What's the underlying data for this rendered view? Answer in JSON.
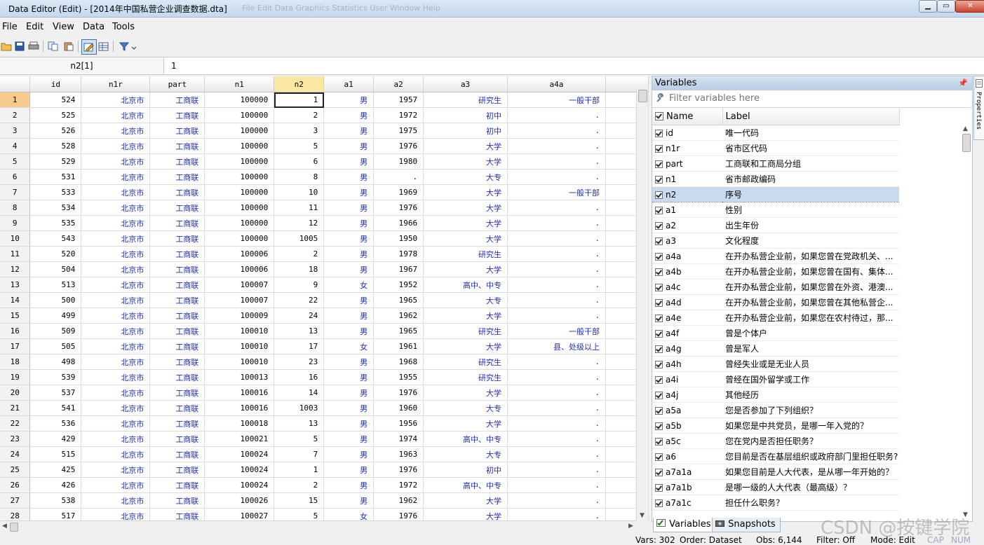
{
  "window": {
    "title": "Data Editor (Edit) - [2014年中国私营企业调查数据.dta]",
    "ghost_menu": "File   Edit   Data   Graphics   Statistics   User   Window   Help"
  },
  "menu": [
    "File",
    "Edit",
    "View",
    "Data",
    "Tools"
  ],
  "toolbar": {
    "icons": [
      "open-icon",
      "save-icon",
      "print-icon",
      "copy-icon",
      "paste-icon",
      "edit-mode-icon",
      "browse-mode-icon",
      "filter-icon"
    ]
  },
  "cellbar": {
    "ref": "n2[1]",
    "value": "1"
  },
  "grid": {
    "columns": [
      "id",
      "n1r",
      "part",
      "n1",
      "n2",
      "a1",
      "a2",
      "a3",
      "a4a"
    ],
    "rows": [
      [
        "1",
        "524",
        "北京市",
        "工商联",
        "100000",
        "1",
        "男",
        "1957",
        "研究生",
        "一般干部"
      ],
      [
        "2",
        "525",
        "北京市",
        "工商联",
        "100000",
        "2",
        "男",
        "1972",
        "初中",
        "."
      ],
      [
        "3",
        "526",
        "北京市",
        "工商联",
        "100000",
        "3",
        "男",
        "1975",
        "初中",
        "."
      ],
      [
        "4",
        "528",
        "北京市",
        "工商联",
        "100000",
        "5",
        "男",
        "1976",
        "大学",
        "."
      ],
      [
        "5",
        "529",
        "北京市",
        "工商联",
        "100000",
        "6",
        "男",
        "1980",
        "大学",
        "."
      ],
      [
        "6",
        "531",
        "北京市",
        "工商联",
        "100000",
        "8",
        "男",
        ".",
        "大专",
        "."
      ],
      [
        "7",
        "533",
        "北京市",
        "工商联",
        "100000",
        "10",
        "男",
        "1969",
        "大学",
        "一般干部"
      ],
      [
        "8",
        "534",
        "北京市",
        "工商联",
        "100000",
        "11",
        "男",
        "1976",
        "大学",
        "."
      ],
      [
        "9",
        "535",
        "北京市",
        "工商联",
        "100000",
        "12",
        "男",
        "1966",
        "大学",
        "."
      ],
      [
        "10",
        "543",
        "北京市",
        "工商联",
        "100000",
        "1005",
        "男",
        "1950",
        "大学",
        "."
      ],
      [
        "11",
        "520",
        "北京市",
        "工商联",
        "100006",
        "2",
        "男",
        "1978",
        "研究生",
        "."
      ],
      [
        "12",
        "504",
        "北京市",
        "工商联",
        "100006",
        "18",
        "男",
        "1967",
        "大学",
        "."
      ],
      [
        "13",
        "513",
        "北京市",
        "工商联",
        "100007",
        "9",
        "女",
        "1952",
        "高中、中专",
        "."
      ],
      [
        "14",
        "500",
        "北京市",
        "工商联",
        "100007",
        "22",
        "男",
        "1965",
        "大专",
        "."
      ],
      [
        "15",
        "499",
        "北京市",
        "工商联",
        "100009",
        "24",
        "男",
        "1962",
        "大学",
        "."
      ],
      [
        "16",
        "509",
        "北京市",
        "工商联",
        "100010",
        "13",
        "男",
        "1965",
        "研究生",
        "一般干部"
      ],
      [
        "17",
        "505",
        "北京市",
        "工商联",
        "100010",
        "17",
        "女",
        "1961",
        "大学",
        "县、处级以上"
      ],
      [
        "18",
        "498",
        "北京市",
        "工商联",
        "100010",
        "23",
        "男",
        "1968",
        "研究生",
        "."
      ],
      [
        "19",
        "539",
        "北京市",
        "工商联",
        "100013",
        "16",
        "男",
        "1955",
        "研究生",
        "."
      ],
      [
        "20",
        "537",
        "北京市",
        "工商联",
        "100016",
        "14",
        "男",
        "1976",
        "大学",
        "."
      ],
      [
        "21",
        "541",
        "北京市",
        "工商联",
        "100016",
        "1003",
        "男",
        "1960",
        "大专",
        "."
      ],
      [
        "22",
        "536",
        "北京市",
        "工商联",
        "100018",
        "13",
        "男",
        "1956",
        "大学",
        "."
      ],
      [
        "23",
        "429",
        "北京市",
        "工商联",
        "100021",
        "5",
        "男",
        "1974",
        "高中、中专",
        "."
      ],
      [
        "24",
        "515",
        "北京市",
        "工商联",
        "100024",
        "7",
        "男",
        "1963",
        "大专",
        "."
      ],
      [
        "25",
        "425",
        "北京市",
        "工商联",
        "100024",
        "1",
        "男",
        "1976",
        "初中",
        "."
      ],
      [
        "26",
        "426",
        "北京市",
        "工商联",
        "100024",
        "2",
        "男",
        "1972",
        "高中、中专",
        "."
      ],
      [
        "27",
        "538",
        "北京市",
        "工商联",
        "100026",
        "15",
        "男",
        "1962",
        "大学",
        "."
      ],
      [
        "28",
        "517",
        "北京市",
        "工商联",
        "100027",
        "5",
        "女",
        "1976",
        "大学",
        "."
      ]
    ]
  },
  "variables": {
    "title": "Variables",
    "filter_placeholder": "Filter variables here",
    "col_name": "Name",
    "col_label": "Label",
    "items": [
      {
        "name": "id",
        "label": "唯一代码"
      },
      {
        "name": "n1r",
        "label": "省市区代码"
      },
      {
        "name": "part",
        "label": "工商联和工商局分组"
      },
      {
        "name": "n1",
        "label": "省市邮政编码"
      },
      {
        "name": "n2",
        "label": "序号"
      },
      {
        "name": "a1",
        "label": "性别"
      },
      {
        "name": "a2",
        "label": "出生年份"
      },
      {
        "name": "a3",
        "label": "文化程度"
      },
      {
        "name": "a4a",
        "label": "在开办私营企业前，如果您曾在党政机关、..."
      },
      {
        "name": "a4b",
        "label": "在开办私营企业前，如果您曾在国有、集体..."
      },
      {
        "name": "a4c",
        "label": "在开办私营企业前，如果您曾在外资、港澳..."
      },
      {
        "name": "a4d",
        "label": "在开办私营企业前，如果您曾在其他私营企..."
      },
      {
        "name": "a4e",
        "label": "在开办私营企业前，如果您在农村待过，那..."
      },
      {
        "name": "a4f",
        "label": "曾是个体户"
      },
      {
        "name": "a4g",
        "label": "曾是军人"
      },
      {
        "name": "a4h",
        "label": "曾经失业或是无业人员"
      },
      {
        "name": "a4i",
        "label": "曾经在国外留学或工作"
      },
      {
        "name": "a4j",
        "label": "其他经历"
      },
      {
        "name": "a5a",
        "label": "您是否参加了下列组织？"
      },
      {
        "name": "a5b",
        "label": "如果您是中共党员，是哪一年入党的？"
      },
      {
        "name": "a5c",
        "label": "您在党内是否担任职务？"
      },
      {
        "name": "a6",
        "label": "您目前是否在基层组织或政府部门里担任职务?"
      },
      {
        "name": "a7a1a",
        "label": "如果您目前是人大代表，是从哪一年开始的？"
      },
      {
        "name": "a7a1b",
        "label": "是哪一级的人大代表（最高级）？"
      },
      {
        "name": "a7a1c",
        "label": "担任什么职务？"
      }
    ]
  },
  "tabs": {
    "variables": "Variables",
    "snapshots": "Snapshots"
  },
  "properties_label": "Properties",
  "status": {
    "vars": "Vars: 302",
    "order": "Order: Dataset",
    "obs": "Obs: 6,144",
    "filter": "Filter: Off",
    "mode": "Mode: Edit",
    "cap": "CAP",
    "num": "NUM"
  },
  "watermark": "CSDN @按键学院",
  "colors": {
    "string_value": "#1f2dbb",
    "selected_col_header": "#fbe7a1",
    "selected_row_number": "#f8cb8b",
    "selected_variable": "#c9d9ee"
  }
}
